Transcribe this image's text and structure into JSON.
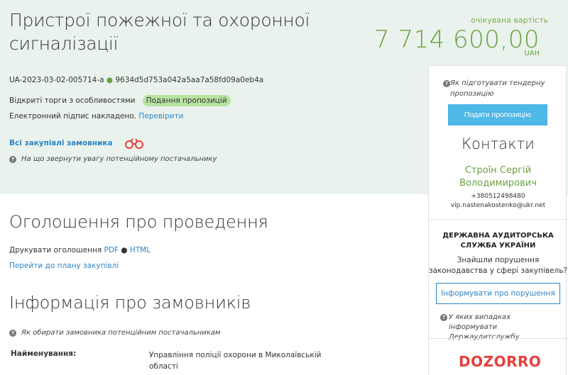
{
  "tender": {
    "title_line1": "Пристрої пожежної та охоронної",
    "title_line2": "сигналізації",
    "expected_cost_label": "очікувана вартість",
    "expected_cost": "7 714 600,00",
    "currency": "UAH",
    "tender_id": "UA-2023-03-02-005714-a",
    "tender_hash": "9634d5d753a042a5aa7a58fd09a0eb4a",
    "procedure_type": "Відкриті торги з особливостями",
    "status_badge": "Подання пропозицій",
    "signature_text": "Електронний підпис накладено.",
    "signature_check_link": "Перевірити",
    "all_purchases_link": "Всі закупівлі замовника",
    "attention_note": "На що звернути увагу потенційному постачальнику"
  },
  "announcement": {
    "heading": "Оголошення про проведення",
    "print_label": "Друкувати оголошення",
    "pdf_link": "PDF",
    "html_link": "HTML",
    "plan_link": "Перейти до плану закупівлі"
  },
  "customers": {
    "heading": "Інформація про замовників",
    "choose_note": "Як обирати замовника потенційним постачальникам",
    "name_label": "Найменування:",
    "name_value": "Управління поліції охорони в Миколаївській області"
  },
  "sidebar": {
    "prepare_note": "Як підготувати тендерну пропозицію",
    "submit_button": "Подати пропозицію",
    "contacts_heading": "Контакти",
    "contact_name": "Строїн Сергій Володимирович",
    "contact_phone": "+380512498480",
    "contact_email": "vip.nastenakostenko@ukr.net",
    "audit_heading": "ДЕРЖАВНА АУДИТОРСЬКА СЛУЖБА УКРАЇНИ",
    "audit_question": "Знайшли порушення законодавства у сфері закупівель?",
    "report_button": "Інформувати про порушення",
    "audit_note": "У яких випадках інформувати Держаудитслужбу",
    "dozorro_logo": "DOZORRO"
  },
  "colors": {
    "accent_green": "#6aa041",
    "link_blue": "#2e85c6",
    "button_blue": "#4eb8e6",
    "hero_bg": "#e9f2ec",
    "badge_bg": "#b9e3a1",
    "dozorro_red": "#e5403c"
  }
}
